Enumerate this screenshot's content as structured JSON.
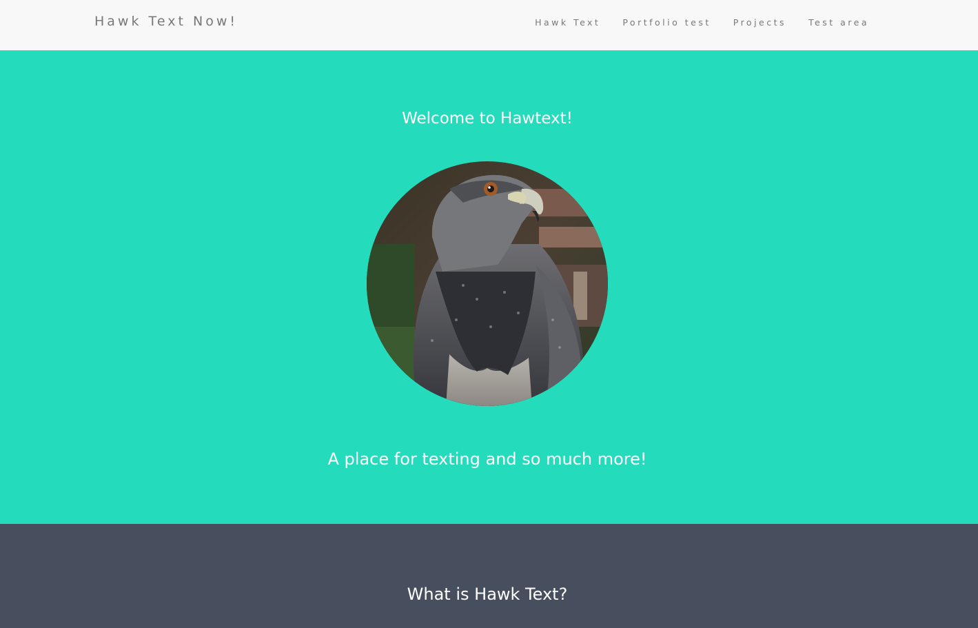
{
  "navbar": {
    "brand": "Hawk Text Now!",
    "links": [
      {
        "label": "Hawk Text"
      },
      {
        "label": "Portfolio test"
      },
      {
        "label": "Projects"
      },
      {
        "label": "Test area"
      }
    ]
  },
  "hero": {
    "title": "Welcome to Hawtext!",
    "image_subject": "hawk",
    "tagline": "A place for texting and so much more!"
  },
  "about": {
    "title": "What is Hawk Text?"
  },
  "colors": {
    "navbar_bg": "#f8f8f8",
    "hero_bg": "#24dbbc",
    "about_bg": "#474e5d",
    "nav_text": "#777777",
    "heading_text": "#ffffff"
  }
}
